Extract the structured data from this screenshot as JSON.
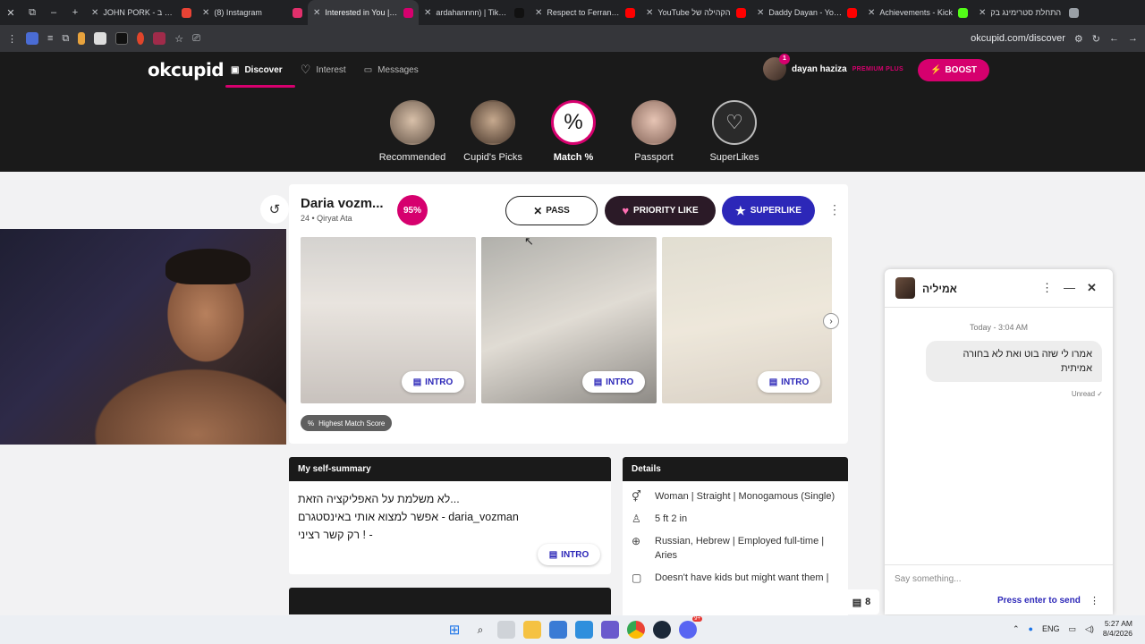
{
  "browser": {
    "tabs": [
      {
        "label": "JOHN PORK - ישוע ב",
        "color": "#ea4335",
        "active": false
      },
      {
        "label": "(8) Instagram",
        "color": "#e1306c",
        "active": false
      },
      {
        "label": "Interested in You | Ol",
        "color": "#d6006e",
        "active": true
      },
      {
        "label": "ardahannnn) | TikTok",
        "color": "#111111",
        "active": false
      },
      {
        "label": "Respect to Ferran Tor",
        "color": "#ff0000",
        "active": false
      },
      {
        "label": "YouTube הקהילה של",
        "color": "#ff0000",
        "active": false
      },
      {
        "label": "Daddy Dayan - YouTu",
        "color": "#ff0000",
        "active": false
      },
      {
        "label": "Achievements - Kick",
        "color": "#53fc18",
        "active": false
      },
      {
        "label": "התחלת סטרימינג בק",
        "color": "#9aa0a6",
        "active": false
      }
    ],
    "url": "okcupid.com/discover"
  },
  "header": {
    "logo": "okcupid",
    "nav": [
      {
        "label": "Discover",
        "icon": "discover-icon"
      },
      {
        "label": "Interest",
        "icon": "heart-icon"
      },
      {
        "label": "Messages",
        "icon": "message-icon"
      }
    ],
    "user_name": "dayan haziza",
    "user_plan": "PREMIUM PLUS",
    "notification_count": "1",
    "boost_label": "BOOST"
  },
  "categories": [
    {
      "label": "Recommended",
      "active": false
    },
    {
      "label": "Cupid's Picks",
      "active": false
    },
    {
      "label": "Match %",
      "active": true,
      "symbol": "%"
    },
    {
      "label": "Passport",
      "active": false
    },
    {
      "label": "SuperLikes",
      "active": false
    }
  ],
  "profile": {
    "name": "Daria vozm...",
    "meta": "24 • Qiryat Ata",
    "match": "95%",
    "pass_label": "PASS",
    "priority_label": "PRIORITY LIKE",
    "superlike_label": "SUPERLIKE",
    "intro_label": "INTRO",
    "highlight": "Highest Match Score"
  },
  "summary": {
    "title": "My self-summary",
    "lines": [
      "לא משלמת על האפליקציה הזאת...",
      "אפשר למצוא אותי באינסטגרם - daria_vozman",
      "רק קשר רציני ! -"
    ],
    "intro_label": "INTRO"
  },
  "details": {
    "title": "Details",
    "rows": [
      {
        "icon": "gender-icon",
        "text": "Woman | Straight | Monogamous (Single)"
      },
      {
        "icon": "height-icon",
        "text": "5 ft 2 in"
      },
      {
        "icon": "globe-icon",
        "text": "Russian, Hebrew | Employed full-time | Aries"
      },
      {
        "icon": "kids-icon",
        "text": "Doesn't have kids but might want them |"
      }
    ]
  },
  "messages_count": "8",
  "chat": {
    "name": "אמיליה",
    "date": "Today - 3:04 AM",
    "message": "אמרו לי שזה בוט ואת לא בחורה אמיתית",
    "status": "Unread ✓",
    "placeholder": "Say something...",
    "send_label": "Press enter to send"
  },
  "taskbar": {
    "lang": "ENG",
    "time": "5:27 AM",
    "date": "8/4/2026",
    "discord_badge": "9+"
  }
}
